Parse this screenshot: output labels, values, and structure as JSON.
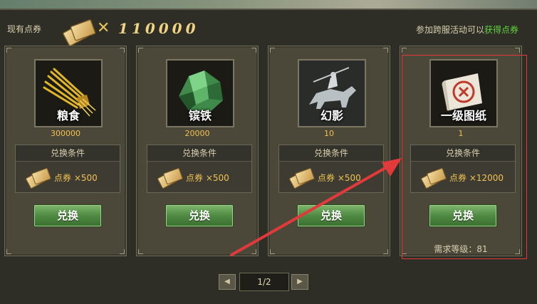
{
  "header": {
    "current_label": "现有点券",
    "multiply_sign": "✕",
    "total_coupons": "110000",
    "hint_prefix": "参加跨服活动可以",
    "hint_link": "获得点券"
  },
  "cards": [
    {
      "name": "粮食",
      "quantity": "300000",
      "condition_title": "兑换条件",
      "cost": "点券 ×500",
      "button": "兑换",
      "icon": "grain-icon"
    },
    {
      "name": "镔铁",
      "quantity": "20000",
      "condition_title": "兑换条件",
      "cost": "点券 ×500",
      "button": "兑换",
      "icon": "iron-ore-icon"
    },
    {
      "name": "幻影",
      "quantity": "10",
      "condition_title": "兑换条件",
      "cost": "点券 ×500",
      "button": "兑换",
      "icon": "phantom-cavalry-icon"
    },
    {
      "name": "一级图纸",
      "quantity": "1",
      "condition_title": "兑换条件",
      "cost": "点券 ×12000",
      "button": "兑换",
      "icon": "blueprint-scroll-icon",
      "level_requirement": "需求等级：81"
    }
  ],
  "pager": {
    "page": "1/2",
    "prev": "◀",
    "next": "▶"
  },
  "colors": {
    "highlight": "#e23a3a",
    "arrow": "#e23a3a",
    "link_green": "#5fd43a",
    "quantity": "#f2c04f"
  }
}
